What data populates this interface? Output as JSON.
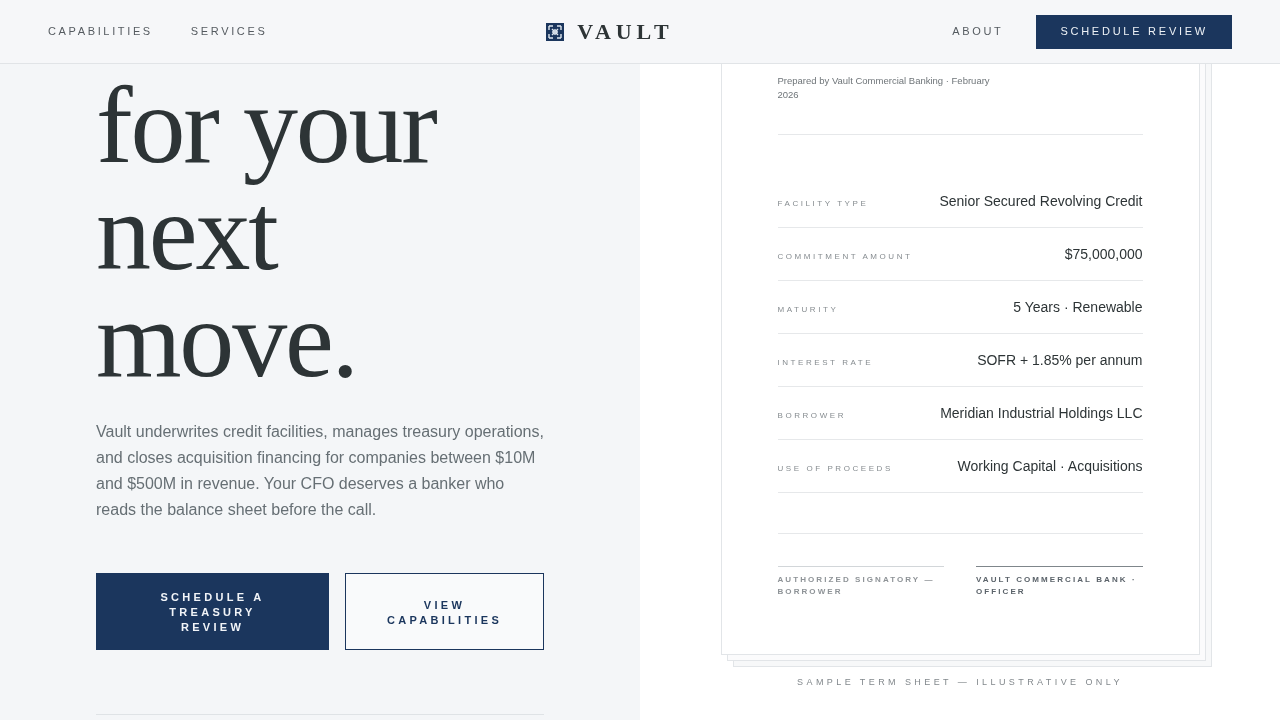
{
  "nav": {
    "left_links": [
      {
        "label": "CAPABILITIES"
      },
      {
        "label": "SERVICES"
      }
    ],
    "brand": "VAULT",
    "right_links": [
      {
        "label": "ABOUT"
      }
    ],
    "cta": "SCHEDULE REVIEW"
  },
  "hero": {
    "heading_lines": [
      "for your",
      "next",
      "move."
    ],
    "text": "Vault underwrites credit facilities, manages treasury operations, and closes acquisition financing for companies between $10M and $500M in revenue. Your CFO deserves a banker who reads the balance sheet before the call.",
    "buttons": [
      {
        "label": "SCHEDULE A TREASURY REVIEW",
        "kind": "primary"
      },
      {
        "label": "VIEW CAPABILITIES",
        "kind": "outline"
      }
    ]
  },
  "term_sheet": {
    "prepared_by": "Prepared by Vault Commercial Banking · February 2026",
    "terms": [
      {
        "label": "FACILITY TYPE",
        "value": "Senior Secured Revolving Credit"
      },
      {
        "label": "COMMITMENT AMOUNT",
        "value": "$75,000,000"
      },
      {
        "label": "MATURITY",
        "value": "5 Years · Renewable"
      },
      {
        "label": "INTEREST RATE",
        "value": "SOFR + 1.85% per annum"
      },
      {
        "label": "BORROWER",
        "value": "Meridian Industrial Holdings LLC"
      },
      {
        "label": "USE OF PROCEEDS",
        "value": "Working Capital · Acquisitions"
      }
    ],
    "signatures": [
      {
        "label": "AUTHORIZED SIGNATORY — BORROWER",
        "kind": "plain"
      },
      {
        "label": "VAULT COMMERCIAL BANK · OFFICER",
        "kind": "accent"
      }
    ],
    "caption": "SAMPLE TERM SHEET — ILLUSTRATIVE ONLY"
  }
}
